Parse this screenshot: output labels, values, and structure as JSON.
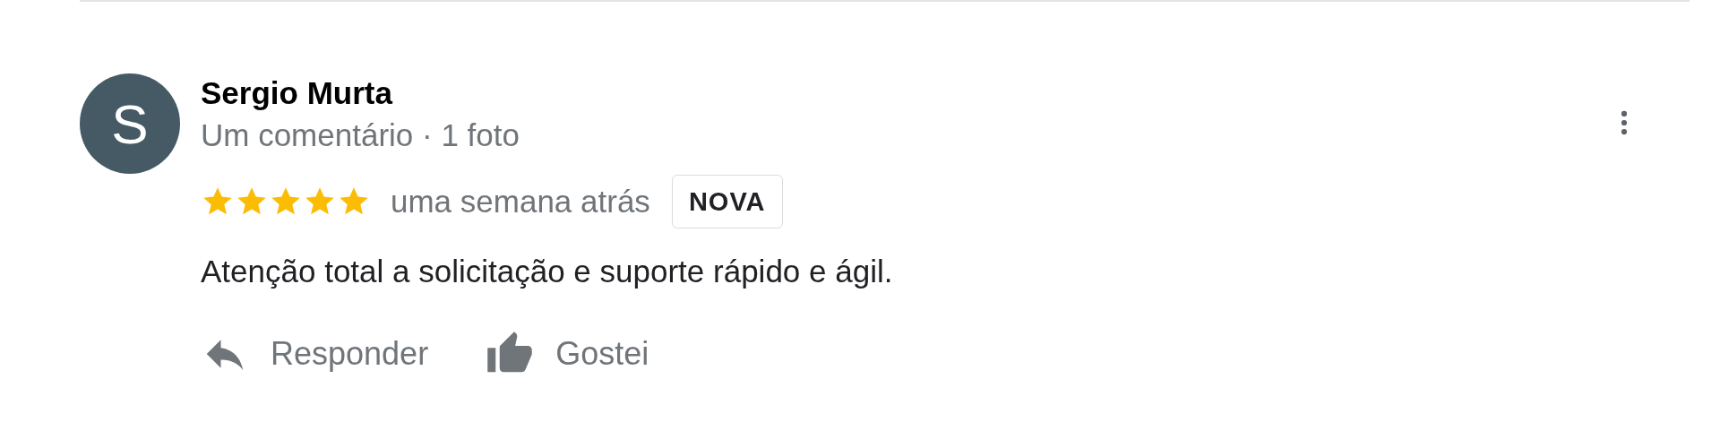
{
  "review": {
    "author": "Sergio Murta",
    "avatar_initial": "S",
    "subtitle": "Um comentário · 1 foto",
    "stars": 5,
    "date": "uma semana atrás",
    "badge": "NOVA",
    "text": "Atenção total a solicitação e suporte rápido e ágil."
  },
  "actions": [
    {
      "kind": "reply",
      "label": "Responder"
    },
    {
      "kind": "like",
      "label": "Gostei"
    }
  ]
}
